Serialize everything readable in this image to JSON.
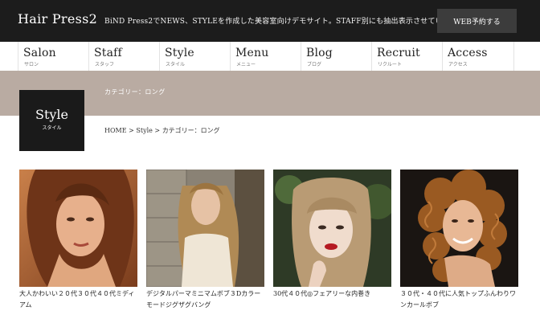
{
  "header": {
    "logo": "Hair Press2",
    "tagline": "BiND Press2でNEWS、STYLEを作成した美容室向けデモサイト。STAFF別にも抽出表示させています。",
    "web_button": "WEB予約する"
  },
  "nav": [
    {
      "label": "Salon",
      "sub": "サロン"
    },
    {
      "label": "Staff",
      "sub": "スタッフ"
    },
    {
      "label": "Style",
      "sub": "スタイル"
    },
    {
      "label": "Menu",
      "sub": "メニュー"
    },
    {
      "label": "Blog",
      "sub": "ブログ"
    },
    {
      "label": "Recruit",
      "sub": "リクルート"
    },
    {
      "label": "Access",
      "sub": "アクセス"
    }
  ],
  "page": {
    "category_title": "カテゴリー：ロング",
    "box_title": "Style",
    "box_sub": "スタイル"
  },
  "breadcrumb": {
    "home": "HOME",
    "sep1": " > ",
    "style": "Style",
    "sep2": " > ",
    "current": "カテゴリー：ロング"
  },
  "styles": [
    {
      "caption": "大人かわいい２０代３０代４０代ミディアム"
    },
    {
      "caption": "デジタルパーマミニマムボブ３Dカラーモードジグザグバング"
    },
    {
      "caption": "30代４０代◎フェアリーな内巻き"
    },
    {
      "caption": "３０代・４０代に人気トップふんわりワンカールボブ"
    }
  ],
  "colors": {
    "topbar": "#1c1c1c",
    "band": "#b9aba2",
    "style_box": "#1a1a1a"
  }
}
